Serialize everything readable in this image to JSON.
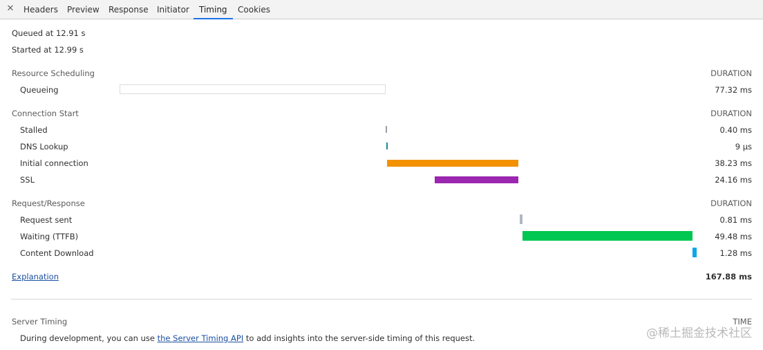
{
  "tabs": {
    "headers": "Headers",
    "preview": "Preview",
    "response": "Response",
    "initiator": "Initiator",
    "timing": "Timing",
    "cookies": "Cookies"
  },
  "summary": {
    "queued": "Queued at 12.91 s",
    "started": "Started at 12.99 s"
  },
  "sections": {
    "resource_scheduling": {
      "title": "Resource Scheduling",
      "column": "DURATION",
      "rows": [
        {
          "label": "Queueing",
          "value": "77.32 ms"
        }
      ]
    },
    "connection_start": {
      "title": "Connection Start",
      "column": "DURATION",
      "rows": [
        {
          "label": "Stalled",
          "value": "0.40 ms"
        },
        {
          "label": "DNS Lookup",
          "value": "9 µs"
        },
        {
          "label": "Initial connection",
          "value": "38.23 ms"
        },
        {
          "label": "SSL",
          "value": "24.16 ms"
        }
      ]
    },
    "request_response": {
      "title": "Request/Response",
      "column": "DURATION",
      "rows": [
        {
          "label": "Request sent",
          "value": "0.81 ms"
        },
        {
          "label": "Waiting (TTFB)",
          "value": "49.48 ms"
        },
        {
          "label": "Content Download",
          "value": "1.28 ms"
        }
      ]
    }
  },
  "explanation": "Explanation",
  "total": "167.88 ms",
  "server_timing": {
    "title": "Server Timing",
    "column": "TIME",
    "text_before": "During development, you can use ",
    "link": "the Server Timing API",
    "text_after": " to add insights into the server-side timing of this request."
  },
  "watermark": "@稀土掘金技术社区",
  "colors": {
    "queueing": "#ffffff",
    "stalled": "#9aa0a6",
    "dns": "#1b8a9a",
    "initial_connection": "#f29200",
    "ssl": "#9b27b0",
    "request_sent": "#b0b8c4",
    "waiting": "#00c751",
    "content_download": "#0ba7e8",
    "active_tab": "#1a73e8"
  }
}
